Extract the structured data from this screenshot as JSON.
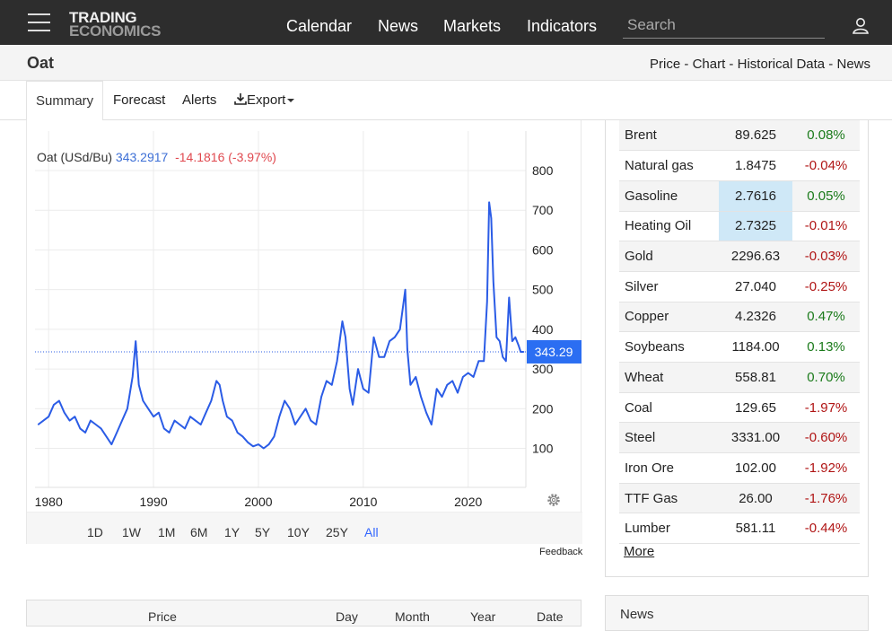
{
  "nav": {
    "logo_line1": "TRADING",
    "logo_line2": "ECONOMICS",
    "links": [
      "Calendar",
      "News",
      "Markets",
      "Indicators"
    ],
    "search_placeholder": "Search"
  },
  "title": "Oat",
  "breadcrumbs": [
    "Price",
    "Chart",
    "Historical Data",
    "News"
  ],
  "tabs": [
    "Summary",
    "Forecast",
    "Alerts",
    "Export"
  ],
  "chart": {
    "legend_name": "Oat (USd/Bu)",
    "legend_last": "343.2917",
    "legend_change": "-14.1816 (-3.97%)",
    "current_label": "343.29",
    "ranges": [
      "1D",
      "1W",
      "1M",
      "6M",
      "1Y",
      "5Y",
      "10Y",
      "25Y",
      "All"
    ],
    "active_range": "All",
    "feedback": "Feedback",
    "colors": {
      "line": "#2b5ce6",
      "last_label_bg": "#2b6ef2",
      "change": "#e0494f"
    }
  },
  "chart_data": {
    "type": "line",
    "title": "",
    "xlabel": "",
    "ylabel": "",
    "x_ticks": [
      "1980",
      "1990",
      "2000",
      "2010",
      "2020"
    ],
    "y_ticks": [
      "100",
      "200",
      "300",
      "400",
      "500",
      "600",
      "700",
      "800"
    ],
    "ylim": [
      20,
      800
    ],
    "xlim": [
      1978.7,
      2025.5
    ],
    "grid": true,
    "series": [
      {
        "name": "Oat (USd/Bu)",
        "x": [
          1979.0,
          1979.5,
          1980.0,
          1980.5,
          1981.0,
          1981.5,
          1982.0,
          1982.5,
          1983.0,
          1983.5,
          1984.0,
          1984.5,
          1985.0,
          1985.5,
          1986.0,
          1986.5,
          1987.0,
          1987.5,
          1988.0,
          1988.3,
          1988.6,
          1989.0,
          1989.5,
          1990.0,
          1990.5,
          1991.0,
          1991.5,
          1992.0,
          1992.5,
          1993.0,
          1993.5,
          1994.0,
          1994.5,
          1995.0,
          1995.5,
          1996.0,
          1996.3,
          1996.6,
          1997.0,
          1997.5,
          1998.0,
          1998.5,
          1999.0,
          1999.5,
          2000.0,
          2000.5,
          2001.0,
          2001.5,
          2002.0,
          2002.5,
          2003.0,
          2003.5,
          2004.0,
          2004.5,
          2005.0,
          2005.5,
          2006.0,
          2006.5,
          2007.0,
          2007.5,
          2008.0,
          2008.3,
          2008.7,
          2009.0,
          2009.5,
          2010.0,
          2010.5,
          2011.0,
          2011.5,
          2012.0,
          2012.5,
          2013.0,
          2013.5,
          2014.0,
          2014.2,
          2014.5,
          2015.0,
          2015.5,
          2016.0,
          2016.5,
          2017.0,
          2017.5,
          2018.0,
          2018.5,
          2019.0,
          2019.5,
          2020.0,
          2020.5,
          2021.0,
          2021.5,
          2021.8,
          2022.0,
          2022.2,
          2022.4,
          2022.7,
          2023.0,
          2023.3,
          2023.6,
          2023.9,
          2024.2,
          2024.5,
          2024.8,
          2025.0,
          2025.3
        ],
        "values": [
          160,
          170,
          180,
          210,
          220,
          190,
          170,
          180,
          150,
          140,
          170,
          160,
          150,
          130,
          110,
          140,
          170,
          200,
          280,
          370,
          260,
          220,
          200,
          180,
          190,
          150,
          140,
          170,
          160,
          150,
          180,
          170,
          160,
          190,
          220,
          270,
          260,
          220,
          180,
          170,
          140,
          130,
          115,
          105,
          110,
          100,
          110,
          130,
          180,
          220,
          200,
          160,
          180,
          200,
          170,
          160,
          230,
          270,
          260,
          320,
          420,
          380,
          250,
          210,
          300,
          250,
          240,
          380,
          330,
          330,
          370,
          380,
          400,
          500,
          350,
          260,
          280,
          230,
          190,
          160,
          250,
          230,
          260,
          270,
          240,
          280,
          290,
          280,
          320,
          320,
          470,
          720,
          680,
          520,
          380,
          370,
          330,
          320,
          480,
          370,
          380,
          360,
          343.29,
          343.29
        ]
      }
    ]
  },
  "markets": {
    "rows": [
      {
        "name": "Brent",
        "price": "89.625",
        "change": "0.08%",
        "dir": "pos",
        "hl": false
      },
      {
        "name": "Natural gas",
        "price": "1.8475",
        "change": "-0.04%",
        "dir": "neg",
        "hl": false
      },
      {
        "name": "Gasoline",
        "price": "2.7616",
        "change": "0.05%",
        "dir": "pos",
        "hl": true
      },
      {
        "name": "Heating Oil",
        "price": "2.7325",
        "change": "-0.01%",
        "dir": "neg",
        "hl": true
      },
      {
        "name": "Gold",
        "price": "2296.63",
        "change": "-0.03%",
        "dir": "neg",
        "hl": false
      },
      {
        "name": "Silver",
        "price": "27.040",
        "change": "-0.25%",
        "dir": "neg",
        "hl": false
      },
      {
        "name": "Copper",
        "price": "4.2326",
        "change": "0.47%",
        "dir": "pos",
        "hl": false
      },
      {
        "name": "Soybeans",
        "price": "1184.00",
        "change": "0.13%",
        "dir": "pos",
        "hl": false
      },
      {
        "name": "Wheat",
        "price": "558.81",
        "change": "0.70%",
        "dir": "pos",
        "hl": false
      },
      {
        "name": "Coal",
        "price": "129.65",
        "change": "-1.97%",
        "dir": "neg",
        "hl": false
      },
      {
        "name": "Steel",
        "price": "3331.00",
        "change": "-0.60%",
        "dir": "neg",
        "hl": false
      },
      {
        "name": "Iron Ore",
        "price": "102.00",
        "change": "-1.92%",
        "dir": "neg",
        "hl": false
      },
      {
        "name": "TTF Gas",
        "price": "26.00",
        "change": "-1.76%",
        "dir": "neg",
        "hl": false
      },
      {
        "name": "Lumber",
        "price": "581.11",
        "change": "-0.44%",
        "dir": "neg",
        "hl": false
      }
    ],
    "more": "More"
  },
  "bottom": {
    "headers": [
      "Price",
      "Day",
      "Month",
      "Year",
      "Date"
    ],
    "news_title": "News"
  }
}
